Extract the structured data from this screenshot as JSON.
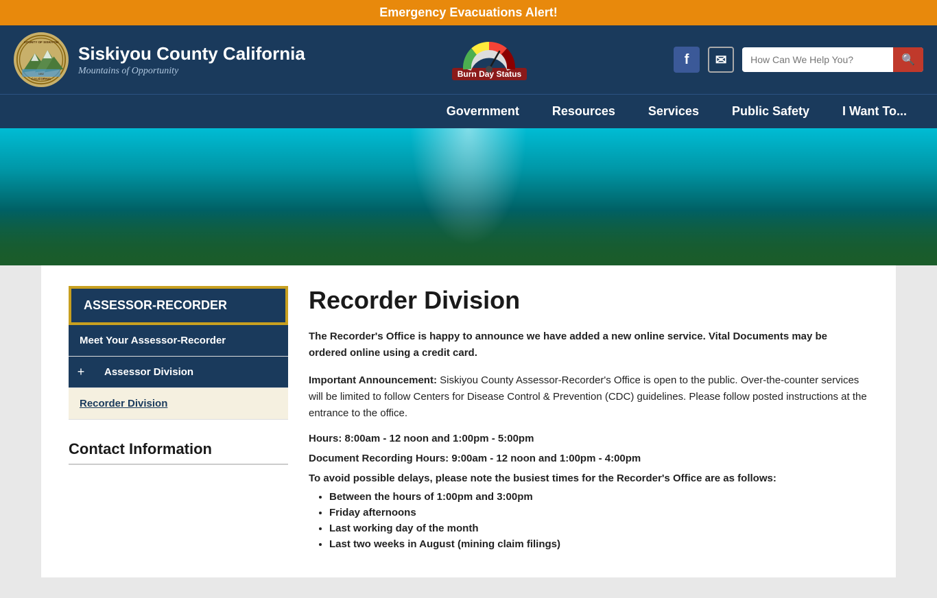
{
  "emergency_alert": {
    "text": "Emergency Evacuations Alert!"
  },
  "header": {
    "site_title": "Siskiyou County California",
    "site_subtitle": "Mountains of Opportunity",
    "burn_day_label": "Burn Day Status",
    "search_placeholder": "How Can We Help You?",
    "facebook_label": "f",
    "search_button_label": "🔍"
  },
  "nav": {
    "items": [
      {
        "label": "Government",
        "href": "#"
      },
      {
        "label": "Resources",
        "href": "#"
      },
      {
        "label": "Services",
        "href": "#"
      },
      {
        "label": "Public Safety",
        "href": "#"
      },
      {
        "label": "I Want To...",
        "href": "#"
      }
    ]
  },
  "sidebar": {
    "section_title": "ASSESSOR-RECORDER",
    "menu_items": [
      {
        "label": "Meet Your Assessor-Recorder",
        "has_expand": false,
        "active": false
      },
      {
        "label": "Assessor Division",
        "has_expand": true,
        "active": false
      },
      {
        "label": "Recorder Division",
        "has_expand": false,
        "active": true
      }
    ],
    "contact_title": "Contact Information"
  },
  "main_content": {
    "page_title": "Recorder Division",
    "intro_bold": "The Recorder's Office is happy to announce we have added a new online service.   Vital Documents may be ordered online using a credit card.",
    "announcement_label": "Important Announcement:",
    "announcement_text": " Siskiyou County Assessor-Recorder's Office is open to the public. Over-the-counter services will be limited to follow Centers for Disease Control & Prevention (CDC) guidelines.  Please follow posted instructions at the entrance to the office.",
    "hours_label": "Hours:",
    "hours_value": " 8:00am - 12 noon and 1:00pm - 5:00pm",
    "doc_hours_label": "Document Recording Hours:",
    "doc_hours_value": "  9:00am - 12 noon and 1:00pm - 4:00pm",
    "busiest_text": "To avoid possible delays, please note the busiest times for the Recorder's Office are as follows:",
    "bullet_items": [
      "Between the hours of 1:00pm and 3:00pm",
      "Friday afternoons",
      "Last working day of the month",
      "Last two weeks in August (mining claim filings)"
    ]
  }
}
